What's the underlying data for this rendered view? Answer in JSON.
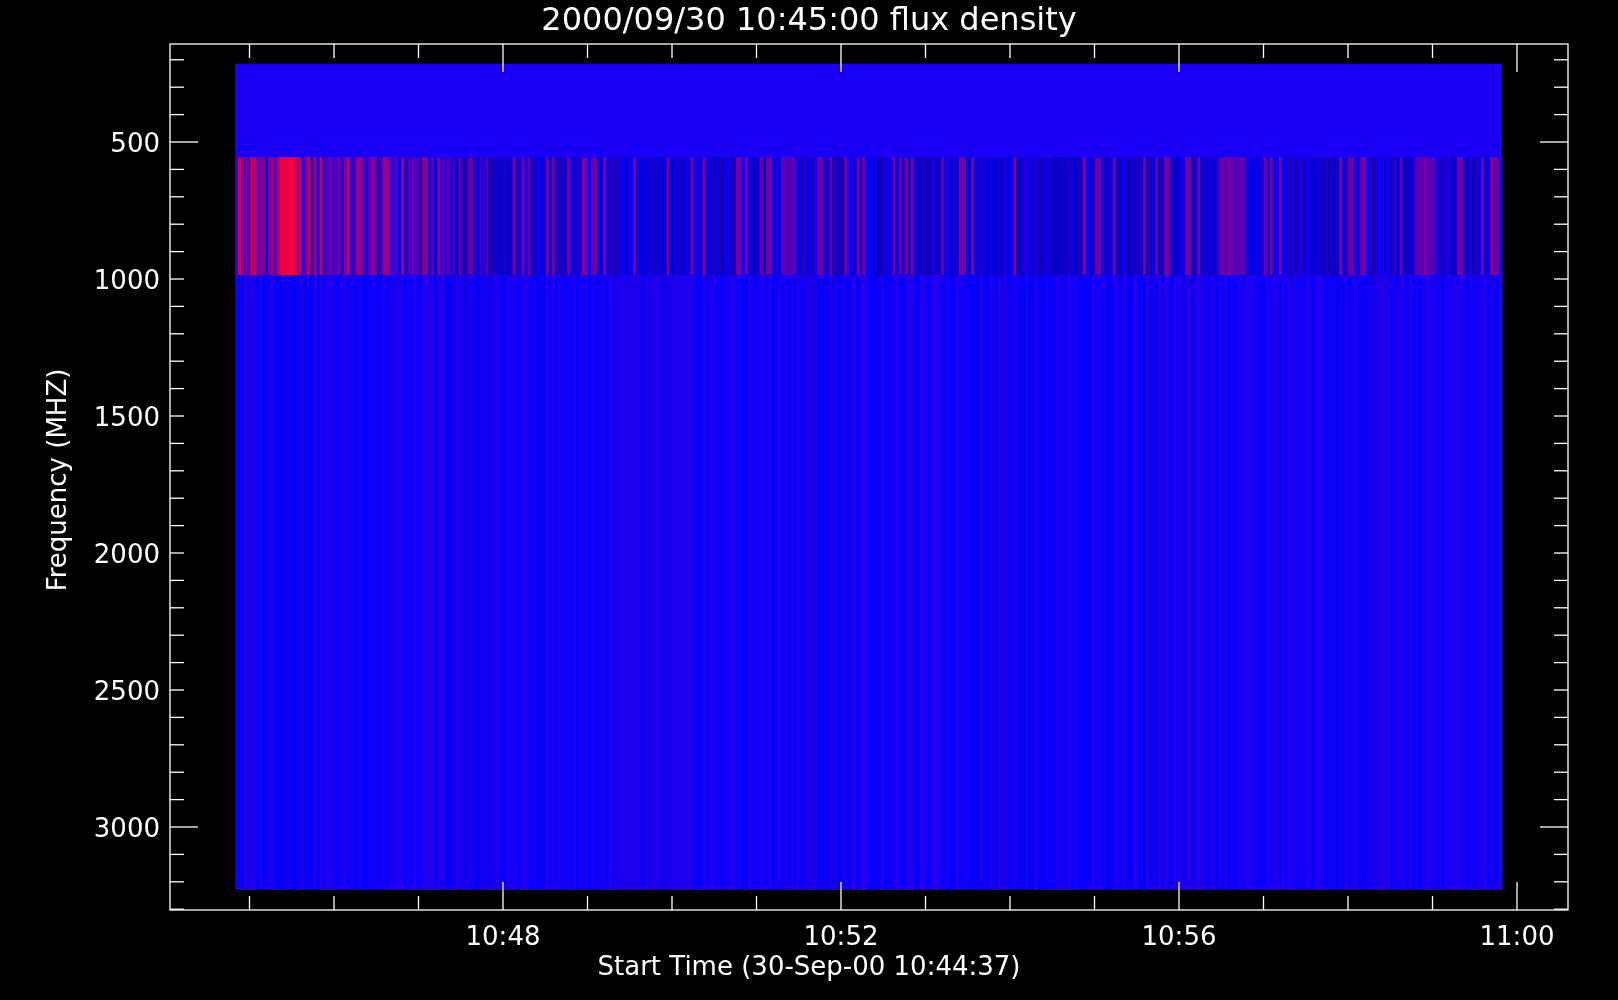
{
  "title": "2000/09/30 10:45:00 flux density",
  "y_axis": {
    "label": "Frequency (MHZ)",
    "ticks": [
      "500",
      "1000",
      "1500",
      "2000",
      "2500",
      "3000"
    ]
  },
  "x_axis": {
    "label": "Start Time (30-Sep-00 10:44:37)",
    "ticks": [
      "10:48",
      "10:52",
      "10:56",
      "11:00"
    ]
  }
}
